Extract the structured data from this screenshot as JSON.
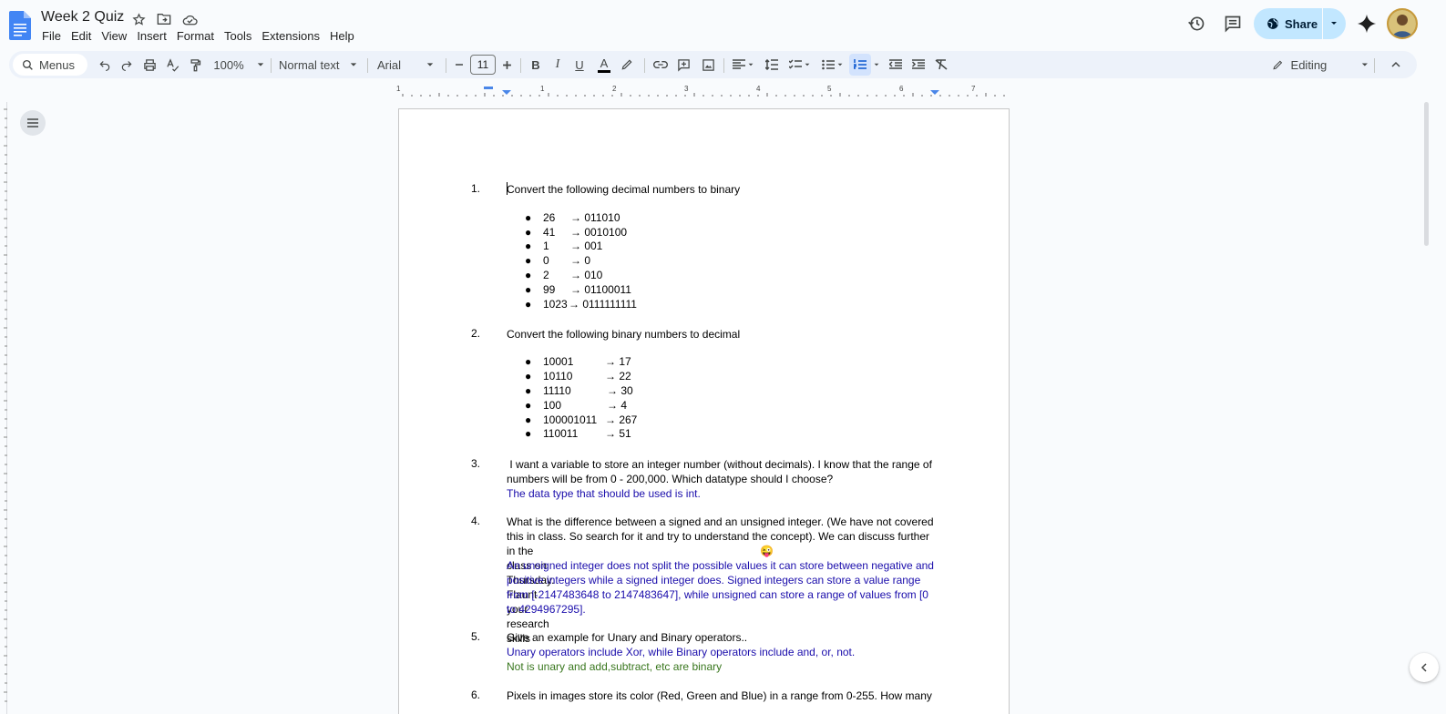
{
  "doc": {
    "title": "Week 2 Quiz"
  },
  "menubar": [
    "File",
    "Edit",
    "View",
    "Insert",
    "Format",
    "Tools",
    "Extensions",
    "Help"
  ],
  "header": {
    "share_label": "Share"
  },
  "toolbar": {
    "menus_label": "Menus",
    "zoom": "100%",
    "style": "Normal text",
    "font": "Arial",
    "font_size": "11",
    "bold": "B",
    "italic": "I",
    "underline": "U",
    "text_color": "A",
    "mode": "Editing"
  },
  "ruler": [
    "1",
    "1",
    "2",
    "3",
    "4",
    "5",
    "6",
    "7"
  ],
  "questions": [
    {
      "num": "1.",
      "text": "Convert the following decimal numbers to binary",
      "bullets": [
        {
          "left": "26",
          "right": "→ 011010"
        },
        {
          "left": "41",
          "right": "→ 0010100"
        },
        {
          "left": "1",
          "right": "→ 001"
        },
        {
          "left": "0",
          "right": "→ 0"
        },
        {
          "left": "2",
          "right": "→ 010"
        },
        {
          "left": "99",
          "right": "→ 01100011"
        },
        {
          "left": "1023",
          "right": "→ 0111111111"
        }
      ]
    },
    {
      "num": "2.",
      "text": "Convert the following binary numbers to decimal",
      "bullets": [
        {
          "left": "10001",
          "right": "→ 17"
        },
        {
          "left": "10110",
          "right": "→ 22"
        },
        {
          "left": "11110",
          "right": "→ 30"
        },
        {
          "left": "100",
          "right": "→ 4"
        },
        {
          "left": "100001011",
          "right": "→ 267"
        },
        {
          "left": "110011",
          "right": "→ 51"
        }
      ]
    },
    {
      "num": "3.",
      "line1": " I want a variable to store an integer number (without decimals). I know that the range of",
      "line2": "numbers will be from 0 - 200,000. Which datatype should I choose?",
      "answer": "The data type that should be used is int."
    },
    {
      "num": "4.",
      "line1": "What is the difference between a signed and an unsigned integer. (We have not covered",
      "line2": "this in class. So search for it and try to understand the concept). We can discuss further",
      "line3": "in the class on Thursday. Flaunt your research skills",
      "emoji": "😜",
      "answer1": "An unsigned integer does not split the possible values it can store between negative and",
      "answer2": "positive integers while a signed integer does. Signed integers can store a value range",
      "answer3": "from [-2147483648 to 2147483647], while unsigned can store a range of values from [0",
      "answer4": "to 4294967295]."
    },
    {
      "num": "5.",
      "line1": "Give an example for Unary and Binary operators..",
      "answer1": "Unary operators include Xor, while Binary operators include and, or, not.",
      "answer2": "Not is unary and add,subtract, etc are binary"
    },
    {
      "num": "6.",
      "line1": "Pixels in images store its color (Red, Green and Blue) in a range from 0-255. How many"
    }
  ],
  "colors": {
    "accent": "#c2e7ff",
    "answer_blue": "#1a0dab",
    "answer_green": "#38761d",
    "toolbar_bg": "#edf2fa"
  }
}
